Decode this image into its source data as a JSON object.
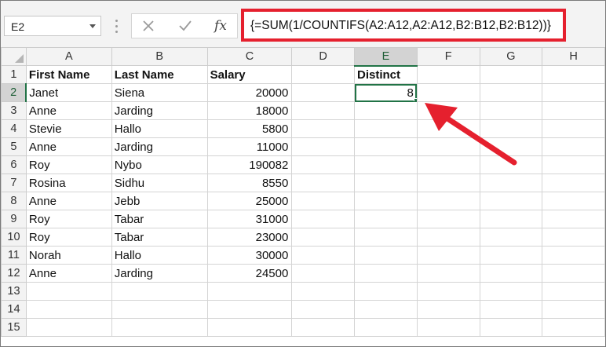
{
  "name_box": {
    "value": "E2"
  },
  "formula_bar": {
    "cancel_icon": "close-icon",
    "enter_icon": "checkmark-icon",
    "function_label": "fx",
    "formula": "{=SUM(1/COUNTIFS(A2:A12,A2:A12,B2:B12,B2:B12))}",
    "highlight_color": "#e5202e"
  },
  "sheet": {
    "columns": [
      "A",
      "B",
      "C",
      "D",
      "E",
      "F",
      "G",
      "H"
    ],
    "rows": [
      "1",
      "2",
      "3",
      "4",
      "5",
      "6",
      "7",
      "8",
      "9",
      "10",
      "11",
      "12",
      "13",
      "14",
      "15"
    ],
    "headers": {
      "first_name": "First Name",
      "last_name": "Last Name",
      "salary": "Salary",
      "distinct": "Distinct"
    },
    "records": [
      {
        "first": "Janet",
        "last": "Siena",
        "salary": "20000"
      },
      {
        "first": "Anne",
        "last": "Jarding",
        "salary": "18000"
      },
      {
        "first": "Stevie",
        "last": "Hallo",
        "salary": "5800"
      },
      {
        "first": "Anne",
        "last": "Jarding",
        "salary": "11000"
      },
      {
        "first": "Roy",
        "last": "Nybo",
        "salary": "190082"
      },
      {
        "first": "Rosina",
        "last": "Sidhu",
        "salary": "8550"
      },
      {
        "first": "Anne",
        "last": "Jebb",
        "salary": "25000"
      },
      {
        "first": "Roy",
        "last": "Tabar",
        "salary": "31000"
      },
      {
        "first": "Roy",
        "last": "Tabar",
        "salary": "23000"
      },
      {
        "first": "Norah",
        "last": "Hallo",
        "salary": "30000"
      },
      {
        "first": "Anne",
        "last": "Jarding",
        "salary": "24500"
      }
    ],
    "distinct_value": "8",
    "active_cell": "E2",
    "selection_color": "#217346",
    "annotation_arrow_color": "#e5202e"
  }
}
